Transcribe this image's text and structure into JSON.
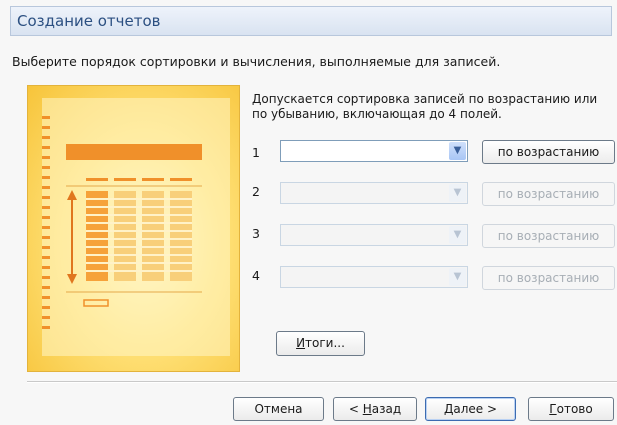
{
  "window": {
    "title": "Создание отчетов"
  },
  "instruction": "Выберите порядок сортировки и вычисления, выполняемые для записей.",
  "info": "Допускается сортировка записей по возрастанию или по убыванию, включающая до 4 полей.",
  "sort_rows": [
    {
      "number": "1",
      "field_value": "",
      "order_label": "по возрастанию",
      "enabled": true
    },
    {
      "number": "2",
      "field_value": "",
      "order_label": "по возрастанию",
      "enabled": false
    },
    {
      "number": "3",
      "field_value": "",
      "order_label": "по возрастанию",
      "enabled": false
    },
    {
      "number": "4",
      "field_value": "",
      "order_label": "по возрастанию",
      "enabled": false
    }
  ],
  "buttons": {
    "summary": {
      "mnemonic": "И",
      "rest": "тоги..."
    },
    "cancel": "Отмена",
    "back": {
      "prefix": "< ",
      "mnemonic": "Н",
      "rest": "азад"
    },
    "next": {
      "mnemonic": "Д",
      "rest": "алее >"
    },
    "finish": {
      "mnemonic": "Г",
      "rest": "отово"
    }
  },
  "colors": {
    "title_text": "#2b4f81",
    "illustration_gold": "#f7c43a",
    "illustration_orange": "#f0902a"
  },
  "icons": [
    "dropdown-arrow-icon",
    "report-illustration"
  ]
}
